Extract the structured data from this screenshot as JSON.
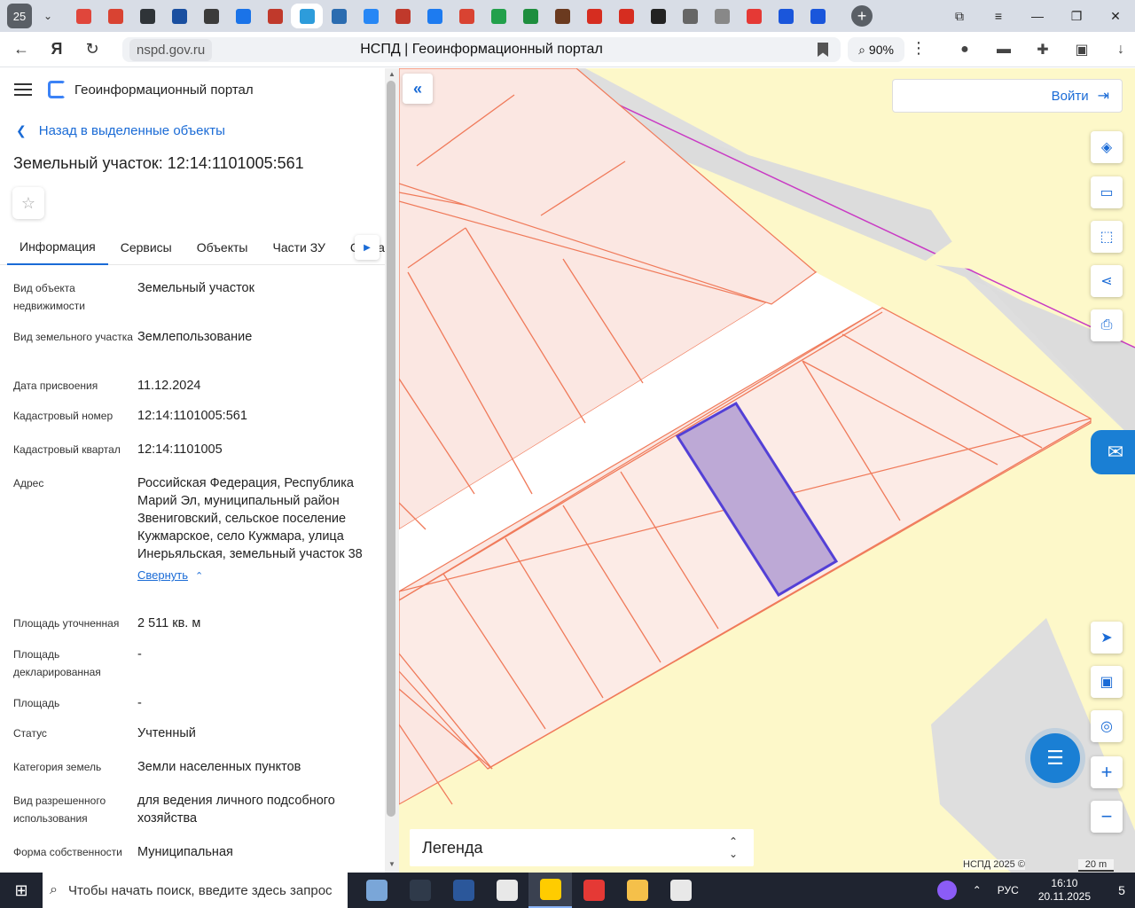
{
  "browser": {
    "tab_count": "25",
    "url_domain": "nspd.gov.ru",
    "page_title": "НСПД | Геоинформационный портал",
    "zoom": "90%",
    "tab_icons": [
      "#e0463b",
      "#d94332",
      "#2f3438",
      "#1a4fa0",
      "#3b3b3b",
      "#1a73e8",
      "#c0392b",
      "#2d9cdb",
      "#2b6cb0",
      "#2787f5",
      "#c0392b",
      "#1d7bf0",
      "#d94332",
      "#22a04b",
      "#1e8e3e",
      "#6b3a1f",
      "#d62d20",
      "#d62d20",
      "#222",
      "#666",
      "#888",
      "#e53935",
      "#1a56db",
      "#1a56db"
    ]
  },
  "panel": {
    "app_title": "Геоинформационный портал",
    "back_label": "Назад в выделенные объекты",
    "title": "Земельный участок: 12:14:1101005:561",
    "tabs": [
      "Информация",
      "Сервисы",
      "Объекты",
      "Части ЗУ",
      "Соста"
    ],
    "props": [
      {
        "label": "Вид объекта недвижимости",
        "value": "Земельный участок"
      },
      {
        "label": "Вид земельного участка",
        "value": "Землепользование"
      },
      {
        "label": "Дата присвоения",
        "value": "11.12.2024"
      },
      {
        "label": "Кадастровый номер",
        "value": "12:14:1101005:561"
      },
      {
        "label": "Кадастровый квартал",
        "value": "12:14:1101005"
      },
      {
        "label": "Адрес",
        "value": "Российская Федерация, Республика Марий Эл, муниципальный район Звениговский, сельское поселение Кужмарское, село Кужмара, улица Инерьяльская, земельный участок 38"
      },
      {
        "label": "Площадь уточненная",
        "value": "2 511 кв. м"
      },
      {
        "label": "Площадь декларированная",
        "value": "-"
      },
      {
        "label": "Площадь",
        "value": "-"
      },
      {
        "label": "Статус",
        "value": "Учтенный"
      },
      {
        "label": "Категория земель",
        "value": "Земли населенных пунктов"
      },
      {
        "label": "Вид разрешенного использования",
        "value": "для ведения личного подсобного хозяйства"
      },
      {
        "label": "Форма собственности",
        "value": "Муниципальная"
      }
    ],
    "collapse_label": "Свернуть"
  },
  "map": {
    "login_label": "Войти",
    "legend_label": "Легенда",
    "copyright": "НСПД 2025 ©",
    "scale": "20 m",
    "tool_icons": [
      "layers-icon",
      "ruler-icon",
      "area-select-icon",
      "share-icon",
      "print-icon",
      "locate-icon",
      "minimap-icon",
      "search-location-icon",
      "zoom-in-icon",
      "zoom-out-icon"
    ]
  },
  "taskbar": {
    "search_placeholder": "Чтобы начать поиск, введите здесь запрос",
    "lang": "РУС",
    "time": "16:10",
    "date": "20.11.2025",
    "notif_count": "5",
    "app_colors": [
      "#7aa6d8",
      "#2f3a4a",
      "#2b579a",
      "#e8e8e8",
      "#ffcc00",
      "#e53935",
      "#f5c04a",
      "#e8e8e8"
    ]
  }
}
